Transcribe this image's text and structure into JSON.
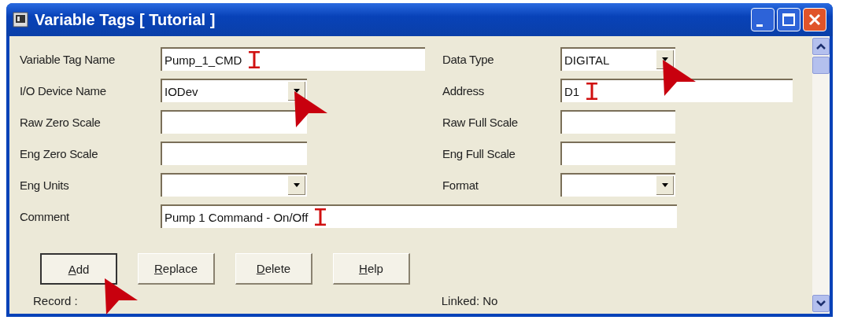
{
  "window": {
    "title": "Variable Tags [ Tutorial ]"
  },
  "rows": [
    {
      "left": {
        "label": "Variable Tag Name",
        "kind": "text",
        "value": "Pump_1_CMD",
        "cursor": true
      },
      "right": {
        "label": "Data Type",
        "kind": "combo",
        "value": "DIGITAL",
        "pointer": true
      }
    },
    {
      "left": {
        "label": "I/O Device Name",
        "kind": "combo",
        "value": "IODev",
        "pointer": true
      },
      "right": {
        "label": "Address",
        "kind": "text",
        "value": "D1",
        "cursor": true
      }
    },
    {
      "left": {
        "label": "Raw Zero Scale",
        "kind": "text"
      },
      "right": {
        "label": "Raw Full Scale",
        "kind": "text"
      }
    },
    {
      "left": {
        "label": "Eng Zero Scale",
        "kind": "text"
      },
      "right": {
        "label": "Eng Full Scale",
        "kind": "text"
      }
    },
    {
      "left": {
        "label": "Eng Units",
        "kind": "combo"
      },
      "right": {
        "label": "Format",
        "kind": "combo"
      }
    }
  ],
  "comment": {
    "label": "Comment",
    "value": "Pump 1 Command - On/Off",
    "cursor": true
  },
  "buttons": [
    {
      "label": "Add",
      "default": true,
      "pointer": true
    },
    {
      "label": "Replace",
      "default": false
    },
    {
      "label": "Delete",
      "default": false
    },
    {
      "label": "Help",
      "default": false
    }
  ],
  "status": {
    "record": "Record :",
    "linked": "Linked: No"
  }
}
